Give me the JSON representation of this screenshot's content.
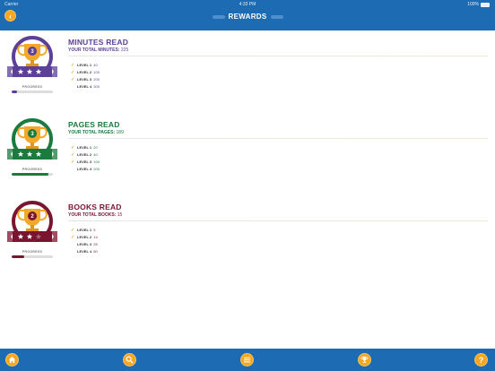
{
  "status_bar": {
    "carrier": "Carrier",
    "time": "4:33 PM",
    "battery": "100%"
  },
  "header": {
    "title": "REWARDS"
  },
  "sections": [
    {
      "title": "MINUTES READ",
      "total_label": "YOUR TOTAL MINUTES:",
      "total_value": "225",
      "color": "#5b3f98",
      "badge_level": "3",
      "stars_filled": 3,
      "progress_label": "PROGRESS",
      "progress": 0.12,
      "levels": [
        {
          "label": "LEVEL 1",
          "value": "40",
          "done": true
        },
        {
          "label": "LEVEL 2",
          "value": "100",
          "done": true
        },
        {
          "label": "LEVEL 3",
          "value": "200",
          "done": true
        },
        {
          "label": "LEVEL 4",
          "value": "300",
          "done": false
        }
      ]
    },
    {
      "title": "PAGES READ",
      "total_label": "YOUR TOTAL PAGES:",
      "total_value": "189",
      "color": "#1b7a3e",
      "badge_level": "3",
      "stars_filled": 3,
      "progress_label": "PROGRESS",
      "progress": 0.9,
      "levels": [
        {
          "label": "LEVEL 1",
          "value": "20",
          "done": true
        },
        {
          "label": "LEVEL 2",
          "value": "40",
          "done": true
        },
        {
          "label": "LEVEL 3",
          "value": "100",
          "done": true
        },
        {
          "label": "LEVEL 4",
          "value": "200",
          "done": false
        }
      ]
    },
    {
      "title": "BOOKS READ",
      "total_label": "YOUR TOTAL BOOKS:",
      "total_value": "15",
      "color": "#7a1530",
      "badge_level": "2",
      "stars_filled": 2,
      "progress_label": "PROGRESS",
      "progress": 0.3,
      "levels": [
        {
          "label": "LEVEL 1",
          "value": "5",
          "done": true
        },
        {
          "label": "LEVEL 2",
          "value": "14",
          "done": true
        },
        {
          "label": "LEVEL 3",
          "value": "25",
          "done": false
        },
        {
          "label": "LEVEL 4",
          "value": "50",
          "done": false
        }
      ]
    }
  ],
  "bottom_nav": [
    {
      "name": "home",
      "icon": "home-icon"
    },
    {
      "name": "search",
      "icon": "search-icon"
    },
    {
      "name": "list",
      "icon": "list-icon"
    },
    {
      "name": "rewards",
      "icon": "trophy-icon"
    },
    {
      "name": "help",
      "icon": "help-icon"
    }
  ],
  "colors": {
    "bar": "#1c6bb3",
    "accent": "#f5a623"
  }
}
